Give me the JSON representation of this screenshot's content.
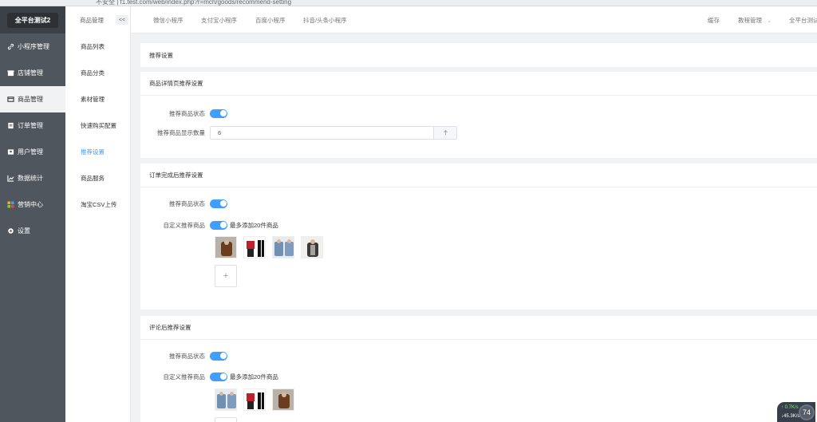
{
  "browser": {
    "url": "不安全 | f1.test.com/web/index.php?r=mch/goods/recommend-setting"
  },
  "sidebar": {
    "brand": "全平台测试2",
    "items": [
      {
        "label": "小程序管理",
        "icon": "link-icon"
      },
      {
        "label": "店铺管理",
        "icon": "store-icon"
      },
      {
        "label": "商品管理",
        "icon": "goods-icon",
        "active": true
      },
      {
        "label": "订单管理",
        "icon": "order-icon"
      },
      {
        "label": "用户管理",
        "icon": "user-icon"
      },
      {
        "label": "数据统计",
        "icon": "chart-icon"
      },
      {
        "label": "营销中心",
        "icon": "marketing-icon"
      },
      {
        "label": "设置",
        "icon": "gear-icon"
      }
    ]
  },
  "submenu": {
    "title": "商品管理",
    "collapse": "<<",
    "items": [
      {
        "label": "商品列表"
      },
      {
        "label": "商品分类"
      },
      {
        "label": "素材管理"
      },
      {
        "label": "快速购买配置"
      },
      {
        "label": "推荐设置",
        "active": true
      },
      {
        "label": "商品服务"
      },
      {
        "label": "淘宝CSV上传"
      }
    ]
  },
  "topnav": {
    "tabs": [
      "微信小程序",
      "支付宝小程序",
      "百度小程序",
      "抖音/头条小程序"
    ],
    "cache": "缓存",
    "tutorial": "教程管理",
    "account": "全平台测试"
  },
  "page": {
    "title": "推荐设置",
    "section1": {
      "title": "商品详情页推荐设置",
      "status_label": "推荐商品状态",
      "count_label": "推荐商品显示数量",
      "count_value": "6"
    },
    "section2": {
      "title": "订单完成后推荐设置",
      "status_label": "推荐商品状态",
      "custom_label": "自定义推荐商品",
      "custom_hint": "最多添加20件商品",
      "add": "+"
    },
    "section3": {
      "title": "评论后推荐设置",
      "status_label": "推荐商品状态",
      "custom_label": "自定义推荐商品",
      "custom_hint": "最多添加20件商品",
      "add": "+"
    }
  },
  "speed": {
    "up": "0.7",
    "up_unit": "K/s",
    "down": "45.3",
    "down_unit": "K/s",
    "percent": "74"
  },
  "colors": {
    "accent": "#409eff",
    "sidebar": "#50565d",
    "brand_bg": "#3c4147"
  }
}
